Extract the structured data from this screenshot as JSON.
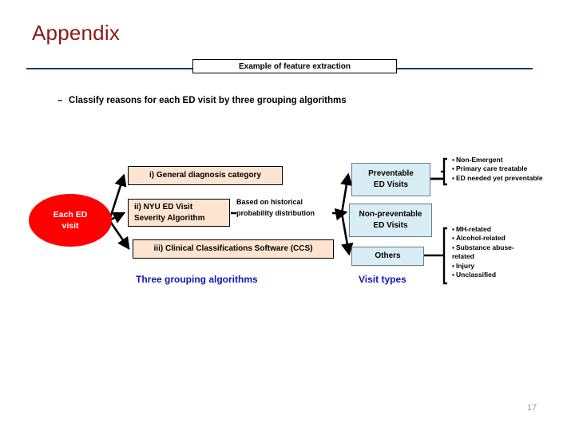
{
  "slide": {
    "title": "Appendix",
    "banner": "Example of feature extraction",
    "page_number": "17",
    "bullet_dash": "–",
    "bullet": "Classify reasons for each ED visit by three grouping algorithms"
  },
  "colors": {
    "title_red": "#8c1b18",
    "rule_navy": "#1f3864",
    "oval_red": "#ff0000",
    "algo_box_fill": "#fce4d0",
    "visit_box_fill": "#d9edf5",
    "visit_box_border": "#5f7f93",
    "caption_blue": "#1414b4",
    "page_number_gray": "#9a9a9a",
    "connector_black": "#000000"
  },
  "source": {
    "label_line1": "Each ED",
    "label_line2": "visit"
  },
  "algorithms": {
    "caption": "Three grouping algorithms",
    "boxes": [
      {
        "label": "i) General diagnosis category"
      },
      {
        "label_line1": "ii) NYU ED Visit",
        "label_line2": "Severity Algorithm"
      },
      {
        "label": "iii) Clinical Classifications Software (CCS)"
      }
    ],
    "annotation_line1": "Based on historical",
    "annotation_line2": "probability distribution"
  },
  "visit_types": {
    "caption": "Visit types",
    "boxes": [
      {
        "label_line1": "Preventable",
        "label_line2": "ED Visits"
      },
      {
        "label_line1": "Non-preventable",
        "label_line2": "ED Visits"
      },
      {
        "label_line1": "Others",
        "label_line2": ""
      }
    ]
  },
  "details": {
    "preventable": [
      "Non-Emergent",
      "Primary care treatable",
      "ED needed yet preventable"
    ],
    "others": [
      "MH-related",
      "Alcohol-related",
      "Substance abuse-related",
      "Injury",
      "Unclassified"
    ]
  }
}
